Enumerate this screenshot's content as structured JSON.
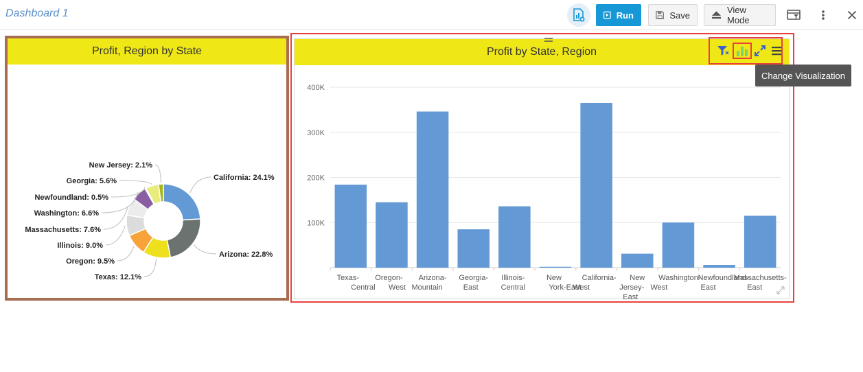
{
  "topbar": {
    "title": "Dashboard 1",
    "add_chart_icon": "add-chart-icon",
    "run_label": "Run",
    "save_label": "Save",
    "view_mode_label": "View Mode",
    "filter_panel_icon": "filter-panel-icon",
    "more_icon": "more-vertical-icon",
    "close_icon": "close-icon"
  },
  "left_panel": {
    "title": "Profit, Region by State"
  },
  "right_panel": {
    "title": "Profit by State, Region",
    "icons": [
      "filter-icon",
      "bar-chart-icon",
      "expand-icon",
      "menu-icon"
    ],
    "tooltip": "Change Visualization"
  },
  "colors": {
    "header_yellow": "#efe816",
    "bar_blue": "#6399d4",
    "left_border": "#a86d51",
    "selection_red": "#e8403c",
    "run_blue": "#1798d6"
  },
  "chart_data": [
    {
      "type": "pie",
      "variant": "donut",
      "title": "Profit, Region by State",
      "slices": [
        {
          "label": "California",
          "value": 24.1,
          "display": "California: 24.1%",
          "color": "#6399d4"
        },
        {
          "label": "Arizona",
          "value": 22.8,
          "display": "Arizona: 22.8%",
          "color": "#6b7370"
        },
        {
          "label": "Texas",
          "value": 12.1,
          "display": "Texas: 12.1%",
          "color": "#eee01c"
        },
        {
          "label": "Oregon",
          "value": 9.5,
          "display": "Oregon: 9.5%",
          "color": "#f8a23a"
        },
        {
          "label": "Illinois",
          "value": 9.0,
          "display": "Illinois: 9.0%",
          "color": "#dcdcdc"
        },
        {
          "label": "Massachusetts",
          "value": 7.6,
          "display": "Massachusetts: 7.6%",
          "color": "#ececec"
        },
        {
          "label": "Washington",
          "value": 6.6,
          "display": "Washington: 6.6%",
          "color": "#8a5ea3"
        },
        {
          "label": "Newfoundland",
          "value": 0.5,
          "display": "Newfoundland: 0.5%",
          "color": "#b8b8b8"
        },
        {
          "label": "Georgia",
          "value": 5.6,
          "display": "Georgia: 5.6%",
          "color": "#e9ec7a"
        },
        {
          "label": "New Jersey",
          "value": 2.1,
          "display": "New Jersey: 2.1%",
          "color": "#a8b81a"
        }
      ]
    },
    {
      "type": "bar",
      "title": "Profit by State, Region",
      "categories": [
        [
          "Texas-",
          "Central"
        ],
        [
          "Oregon-",
          "West"
        ],
        [
          "Arizona-",
          "Mountain"
        ],
        [
          "Georgia-",
          "East"
        ],
        [
          "Illinois-",
          "Central"
        ],
        [
          "New",
          "York-East"
        ],
        [
          "California-",
          "West"
        ],
        [
          "New",
          "Jersey-",
          "East"
        ],
        [
          "Washington-",
          "West"
        ],
        [
          "Newfoundland-",
          "East"
        ],
        [
          "Massachusetts-",
          "East"
        ]
      ],
      "values": [
        184000,
        145000,
        346000,
        85000,
        136000,
        2000,
        365000,
        31000,
        100000,
        6000,
        115000
      ],
      "yticks": [
        "100K",
        "200K",
        "300K",
        "400K"
      ],
      "ylim": [
        0,
        400000
      ],
      "grid": true
    }
  ]
}
